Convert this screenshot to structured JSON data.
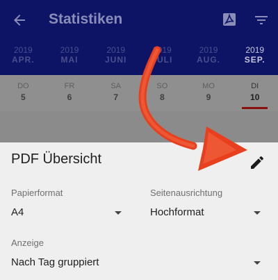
{
  "toolbar": {
    "title": "Statistiken",
    "back_icon": "arrow-back-icon",
    "pdf_icon": "pdf-icon",
    "filter_icon": "filter-icon"
  },
  "months": [
    {
      "year": "2019",
      "label": "APR."
    },
    {
      "year": "2019",
      "label": "MAI"
    },
    {
      "year": "2019",
      "label": "JUNI"
    },
    {
      "year": "2019",
      "label": "JULI"
    },
    {
      "year": "2019",
      "label": "AUG."
    },
    {
      "year": "2019",
      "label": "SEP.",
      "active": true
    }
  ],
  "days": [
    {
      "name": "DO",
      "date": "5"
    },
    {
      "name": "FR",
      "date": "6"
    },
    {
      "name": "SA",
      "date": "7"
    },
    {
      "name": "SO",
      "date": "8"
    },
    {
      "name": "MO",
      "date": "9"
    },
    {
      "name": "DI",
      "date": "10",
      "active": true
    }
  ],
  "sheet": {
    "title": "PDF Übersicht",
    "edit_icon": "pencil-icon",
    "paper_format": {
      "label": "Papierformat",
      "value": "A4"
    },
    "orientation": {
      "label": "Seitenausrichtung",
      "value": "Hochformat"
    },
    "display": {
      "label": "Anzeige",
      "value": "Nach Tag gruppiert"
    }
  },
  "colors": {
    "toolbar_bg": "#0d1466",
    "active_underline": "#8a1010",
    "annotation_arrow": "#e8401f",
    "sheet_bg": "#efefef"
  }
}
